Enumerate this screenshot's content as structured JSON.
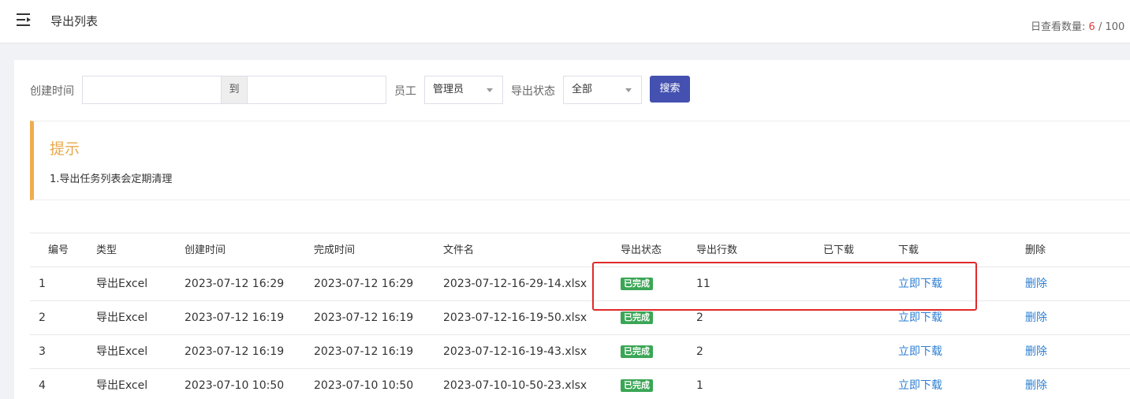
{
  "header": {
    "title": "导出列表",
    "quota_label": "日查看数量:",
    "quota_used": "6",
    "quota_rest": " / 100"
  },
  "filters": {
    "created_label": "创建时间",
    "range_sep": "到",
    "start_value": "",
    "end_value": "",
    "staff_label": "员工",
    "staff_value": "管理员",
    "status_label": "导出状态",
    "status_value": "全部",
    "search_label": "搜索"
  },
  "tip": {
    "title": "提示",
    "text": "1.导出任务列表会定期清理"
  },
  "table": {
    "headers": [
      "编号",
      "类型",
      "创建时间",
      "完成时间",
      "文件名",
      "导出状态",
      "导出行数",
      "已下载",
      "下载",
      "删除"
    ],
    "rows": [
      {
        "id": "1",
        "type": "导出Excel",
        "created": "2023-07-12 16:29",
        "finished": "2023-07-12 16:29",
        "file": "2023-07-12-16-29-14.xlsx",
        "status": "已完成",
        "count": "11",
        "downloaded": "",
        "download": "立即下载",
        "delete": "删除"
      },
      {
        "id": "2",
        "type": "导出Excel",
        "created": "2023-07-12 16:19",
        "finished": "2023-07-12 16:19",
        "file": "2023-07-12-16-19-50.xlsx",
        "status": "已完成",
        "count": "2",
        "downloaded": "",
        "download": "立即下载",
        "delete": "删除"
      },
      {
        "id": "3",
        "type": "导出Excel",
        "created": "2023-07-12 16:19",
        "finished": "2023-07-12 16:19",
        "file": "2023-07-12-16-19-43.xlsx",
        "status": "已完成",
        "count": "2",
        "downloaded": "",
        "download": "立即下载",
        "delete": "删除"
      },
      {
        "id": "4",
        "type": "导出Excel",
        "created": "2023-07-10 10:50",
        "finished": "2023-07-10 10:50",
        "file": "2023-07-10-10-50-23.xlsx",
        "status": "已完成",
        "count": "1",
        "downloaded": "",
        "download": "立即下载",
        "delete": "删除"
      }
    ]
  },
  "colors": {
    "accent": "#4451b0",
    "tip_border": "#f0ad4e",
    "status_done": "#3aa655",
    "link": "#2d7fd3",
    "highlight": "#e02a2a"
  }
}
